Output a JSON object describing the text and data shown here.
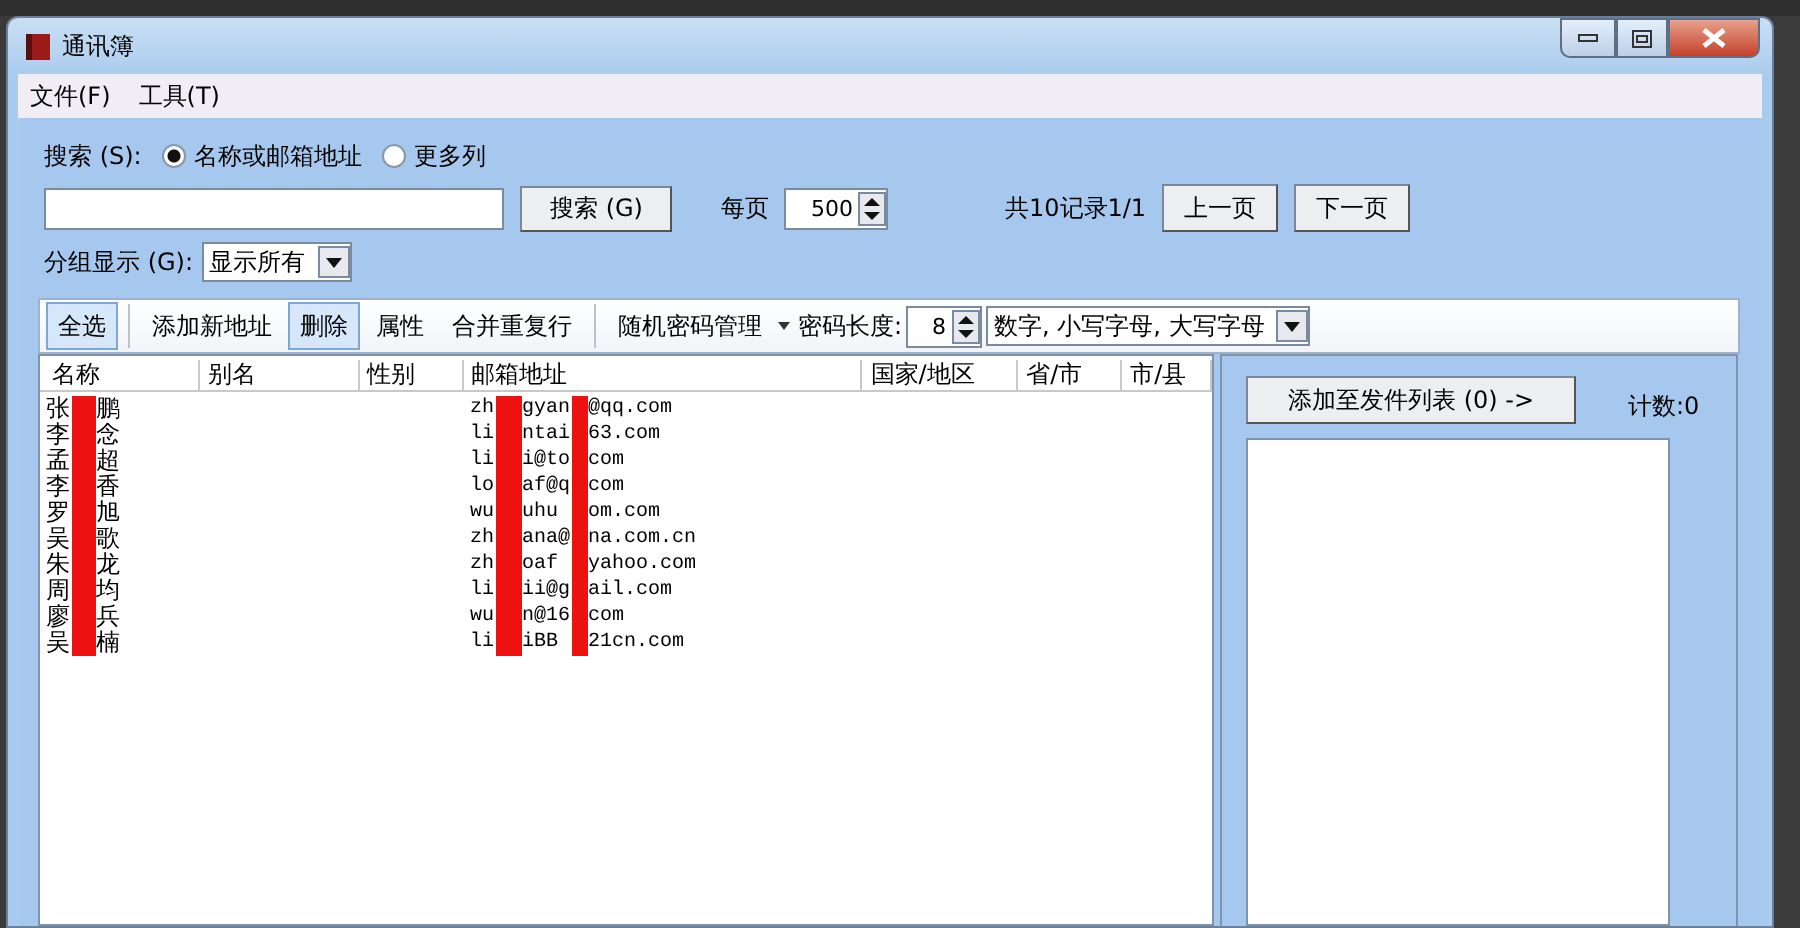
{
  "window": {
    "title": "通讯簿"
  },
  "menu": [
    "文件(F)",
    "工具(T)"
  ],
  "search": {
    "label": "搜索 (S):",
    "options": [
      {
        "label": "名称或邮箱地址",
        "selected": true
      },
      {
        "label": "更多列",
        "selected": false
      }
    ],
    "button": "搜索 (G)",
    "per_page_label": "每页",
    "per_page": "500",
    "record_info": "共10记录1/1",
    "prev": "上一页",
    "next": "下一页"
  },
  "group": {
    "label": "分组显示 (G):",
    "value": "显示所有"
  },
  "toolbar": {
    "groups": [
      [
        {
          "label": "全选",
          "active": true
        }
      ],
      [
        {
          "label": "添加新地址",
          "active": false
        },
        {
          "label": "删除",
          "active": true
        },
        {
          "label": "属性",
          "active": false
        },
        {
          "label": "合并重复行",
          "active": false
        }
      ]
    ],
    "password_menu": "随机密码管理",
    "length_label": "密码长度:",
    "length": "8",
    "charset": "数字, 小写字母, 大写字母"
  },
  "table": {
    "columns": [
      "名称",
      "别名",
      "性别",
      "邮箱地址",
      "国家/地区",
      "省/市",
      "市/县"
    ],
    "rows": [
      {
        "name": [
          "张",
          "鹏"
        ],
        "email": [
          "zh",
          "gyan",
          "@qq.com"
        ]
      },
      {
        "name": [
          "李",
          "念"
        ],
        "email": [
          "li",
          "ntai",
          "63.com"
        ]
      },
      {
        "name": [
          "孟",
          "超"
        ],
        "email": [
          "li",
          "i@to",
          "com"
        ]
      },
      {
        "name": [
          "李",
          "香"
        ],
        "email": [
          "lo",
          "af@q",
          "com"
        ]
      },
      {
        "name": [
          "罗",
          "旭"
        ],
        "email": [
          "wu",
          "uhu",
          "om.com"
        ]
      },
      {
        "name": [
          "吴",
          "歌"
        ],
        "email": [
          "zh",
          "ana@",
          "na.com.cn"
        ]
      },
      {
        "name": [
          "朱",
          "龙"
        ],
        "email": [
          "zh",
          "oaf",
          "yahoo.com"
        ]
      },
      {
        "name": [
          "周",
          "均"
        ],
        "email": [
          "li",
          "ii@g",
          "ail.com"
        ]
      },
      {
        "name": [
          "廖",
          "兵"
        ],
        "email": [
          "wu",
          "n@16",
          "com"
        ]
      },
      {
        "name": [
          "吴",
          "楠"
        ],
        "email": [
          "li",
          "iBB",
          "21cn.com"
        ]
      }
    ]
  },
  "send_panel": {
    "button": "添加至发件列表 (0) ->",
    "count": "计数:0"
  }
}
